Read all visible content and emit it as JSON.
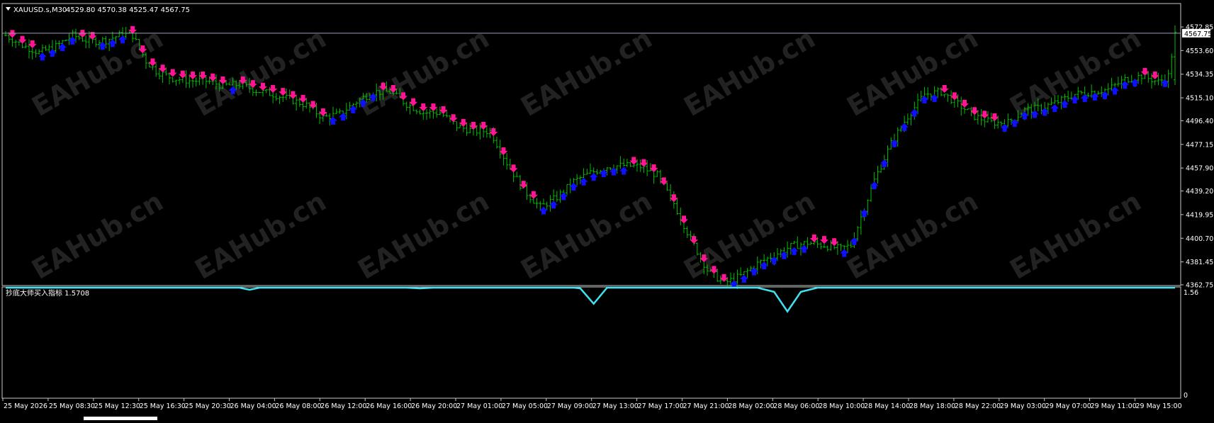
{
  "header": {
    "symbol_line": "XAUUSD.s,M30",
    "ohlc_line": "4529.80 4570.38 4525.47 4567.75"
  },
  "indicator": {
    "label": "抄底大师买入指标 1.5708",
    "scale": [
      "1.56",
      "0"
    ]
  },
  "price_axis": {
    "ticks": [
      "4572.85",
      "4553.60",
      "4534.35",
      "4515.10",
      "4496.40",
      "4477.15",
      "4457.90",
      "4439.20",
      "4419.95",
      "4400.70",
      "4381.45",
      "4362.75"
    ],
    "current_price": "4567.75"
  },
  "time_axis": {
    "ticks": [
      "25 May 2026",
      "25 May 08:30",
      "25 May 12:30",
      "25 May 16:30",
      "25 May 20:30",
      "26 May 04:00",
      "26 May 08:00",
      "26 May 12:00",
      "26 May 16:00",
      "26 May 20:00",
      "27 May 01:00",
      "27 May 05:00",
      "27 May 09:00",
      "27 May 13:00",
      "27 May 17:00",
      "27 May 21:00",
      "28 May 02:00",
      "28 May 06:00",
      "28 May 10:00",
      "28 May 14:00",
      "28 May 18:00",
      "28 May 22:00",
      "29 May 03:00",
      "29 May 07:00",
      "29 May 11:00",
      "29 May 15:00"
    ]
  },
  "watermark": "EAHub.cn",
  "colors": {
    "background": "#000000",
    "bar": "#00c000",
    "down_arrow": "#ff1493",
    "up_arrow": "#1010ff",
    "indicator_line": "#40e0f0",
    "price_line": "#9aa0b4",
    "axis": "#c8c8c8",
    "text": "#ffffff"
  },
  "chart_data": {
    "type": "ohlc",
    "symbol": "XAUUSD.s",
    "timeframe": "M30",
    "last_bar": {
      "open": 4529.8,
      "high": 4570.38,
      "low": 4525.47,
      "close": 4567.75
    },
    "ylim": [
      4362.75,
      4572.85
    ],
    "close_path": [
      [
        0,
        4566
      ],
      [
        5,
        4558
      ],
      [
        10,
        4552
      ],
      [
        15,
        4557
      ],
      [
        20,
        4566
      ],
      [
        25,
        4561
      ],
      [
        30,
        4562
      ],
      [
        35,
        4567
      ],
      [
        38,
        4566
      ],
      [
        42,
        4545
      ],
      [
        45,
        4537
      ],
      [
        50,
        4531
      ],
      [
        55,
        4529
      ],
      [
        60,
        4529
      ],
      [
        65,
        4525
      ],
      [
        70,
        4526
      ],
      [
        75,
        4521
      ],
      [
        80,
        4518
      ],
      [
        85,
        4514
      ],
      [
        90,
        4509
      ],
      [
        95,
        4499
      ],
      [
        100,
        4502
      ],
      [
        105,
        4512
      ],
      [
        110,
        4520
      ],
      [
        115,
        4520
      ],
      [
        120,
        4510
      ],
      [
        125,
        4503
      ],
      [
        130,
        4503
      ],
      [
        135,
        4492
      ],
      [
        140,
        4488
      ],
      [
        145,
        4488
      ],
      [
        150,
        4462
      ],
      [
        155,
        4440
      ],
      [
        160,
        4426
      ],
      [
        165,
        4434
      ],
      [
        170,
        4447
      ],
      [
        175,
        4454
      ],
      [
        180,
        4459
      ],
      [
        185,
        4460
      ],
      [
        190,
        4459
      ],
      [
        195,
        4452
      ],
      [
        200,
        4429
      ],
      [
        205,
        4400
      ],
      [
        210,
        4375
      ],
      [
        215,
        4364
      ],
      [
        220,
        4370
      ],
      [
        225,
        4380
      ],
      [
        230,
        4387
      ],
      [
        235,
        4394
      ],
      [
        240,
        4397
      ],
      [
        245,
        4395
      ],
      [
        250,
        4392
      ],
      [
        253,
        4395
      ],
      [
        256,
        4418
      ],
      [
        260,
        4448
      ],
      [
        265,
        4478
      ],
      [
        270,
        4500
      ],
      [
        275,
        4518
      ],
      [
        280,
        4520
      ],
      [
        285,
        4510
      ],
      [
        290,
        4500
      ],
      [
        295,
        4495
      ],
      [
        300,
        4495
      ],
      [
        305,
        4505
      ],
      [
        310,
        4507
      ],
      [
        315,
        4512
      ],
      [
        320,
        4518
      ],
      [
        325,
        4520
      ],
      [
        330,
        4522
      ],
      [
        335,
        4530
      ],
      [
        340,
        4533
      ],
      [
        345,
        4528
      ],
      [
        348,
        4533
      ],
      [
        350,
        4567
      ]
    ],
    "bar_count": 351,
    "signals": "pink down arrows above bars in declines, blue up arrows below bars in advances",
    "indicator_series": [
      [
        0,
        1.56
      ],
      [
        70,
        1.56
      ],
      [
        73,
        1.53
      ],
      [
        76,
        1.56
      ],
      [
        120,
        1.56
      ],
      [
        124,
        1.55
      ],
      [
        128,
        1.56
      ],
      [
        170,
        1.56
      ],
      [
        172,
        1.55
      ],
      [
        176,
        1.33
      ],
      [
        180,
        1.56
      ],
      [
        225,
        1.56
      ],
      [
        230,
        1.5
      ],
      [
        234,
        1.22
      ],
      [
        238,
        1.5
      ],
      [
        243,
        1.56
      ],
      [
        350,
        1.56
      ]
    ]
  }
}
